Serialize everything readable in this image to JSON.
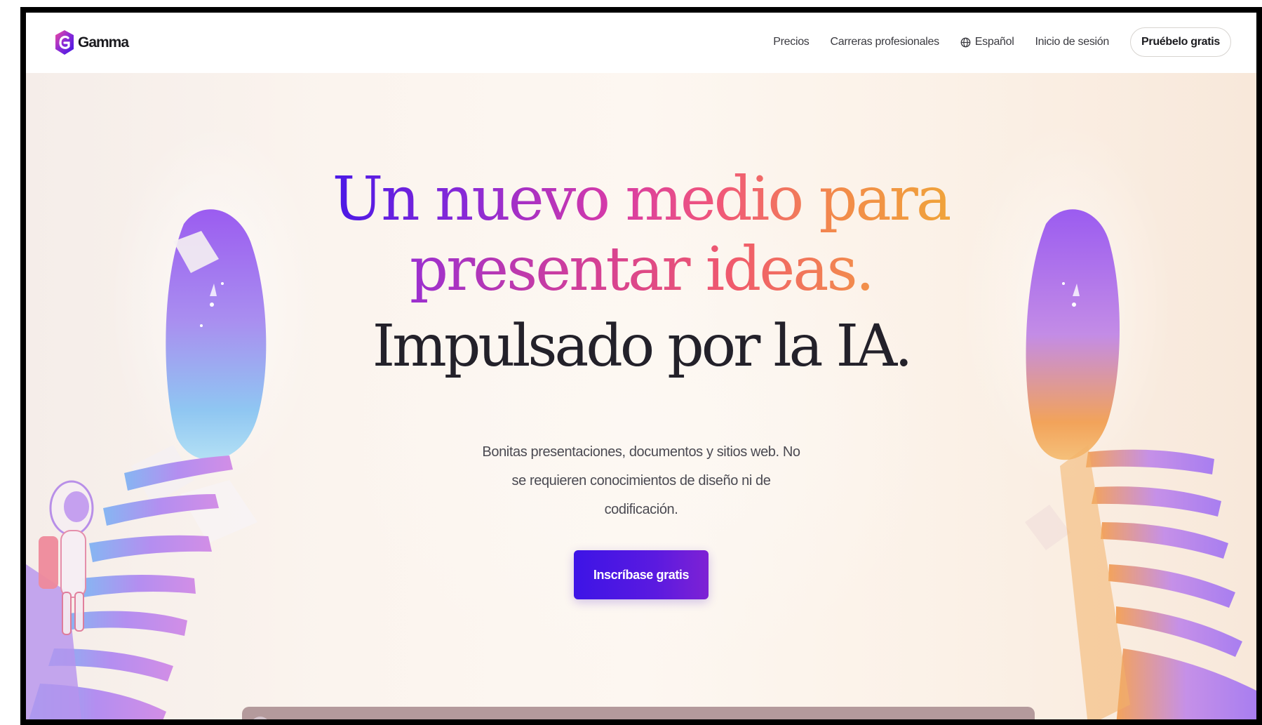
{
  "brand": {
    "name": "Gamma",
    "logo_icon": "gamma-logo-icon",
    "colors": {
      "accent_purple": "#4a18e6",
      "gradient_pink": "#f0567a",
      "gradient_orange": "#f0a33a",
      "cta_bg": "#4e18e2"
    }
  },
  "nav": {
    "links": [
      {
        "label": "Precios"
      },
      {
        "label": "Carreras profesionales"
      },
      {
        "label": "Español",
        "icon": "globe-icon"
      },
      {
        "label": "Inicio de sesión"
      }
    ],
    "cta_label": "Pruébelo gratis"
  },
  "hero": {
    "headline_line1": {
      "part1": "Un nuevo medio para"
    },
    "headline_line2": "presentar ideas.",
    "headline_line3": "Impulsado por la IA.",
    "subtitle": "Bonitas presentaciones, documentos y sitios web. No se requieren conocimientos de diseño ni de codificación.",
    "cta_label": "Inscríbase gratis"
  }
}
